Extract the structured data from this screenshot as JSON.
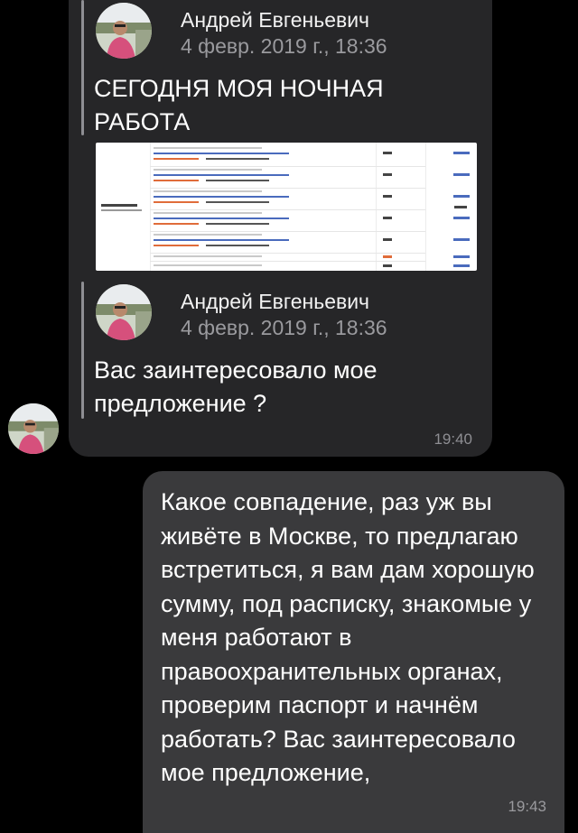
{
  "chat": {
    "incoming": {
      "forwarded": [
        {
          "sender": "Андрей Евгеньевич",
          "date": "4 февр. 2019 г., 18:36",
          "text": "СЕГОДНЯ МОЯ НОЧНАЯ РАБОТА"
        },
        {
          "sender": "Андрей Евгеньевич",
          "date": "4 февр. 2019 г., 18:36",
          "text": "Вас заинтересовало мое предложение ?"
        }
      ],
      "time": "19:40"
    },
    "outgoing": {
      "text": "Какое совпадение, раз уж вы живёте в Москве, то предлагаю встретиться, я вам дам хорошую сумму, под расписку, знакомые у меня работают в правоохранительных органах, проверим паспорт и начнём работать? Вас заинтересовало мое предложение,",
      "time": "19:43"
    }
  },
  "icons": {
    "avatar": "avatar-photo-icon",
    "screenshot": "bet-screenshot-image"
  },
  "colors": {
    "background": "#000000",
    "incoming_bubble": "#262628",
    "outgoing_bubble": "#3a3a3c",
    "secondary_text": "#8e8e93"
  }
}
